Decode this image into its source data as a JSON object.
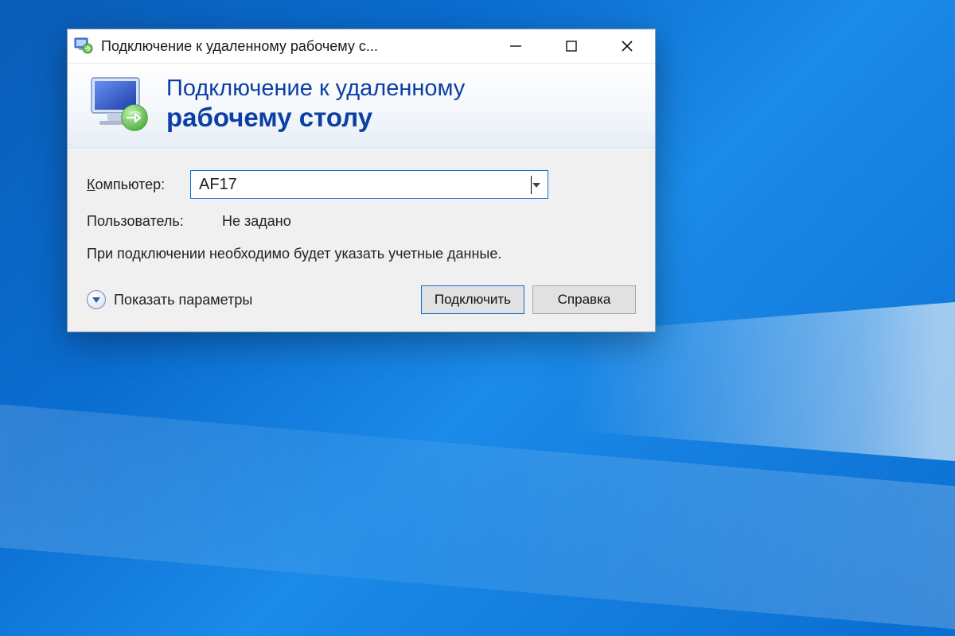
{
  "titlebar": {
    "title": "Подключение к удаленному рабочему с..."
  },
  "banner": {
    "line1": "Подключение к удаленному",
    "line2": "рабочему столу"
  },
  "form": {
    "computer_label": "Компьютер:",
    "computer_value": "AF17",
    "user_label": "Пользователь:",
    "user_value": "Не задано",
    "hint": "При подключении необходимо будет указать учетные данные."
  },
  "footer": {
    "expand_label": "Показать параметры",
    "connect_label": "Подключить",
    "help_label": "Справка"
  }
}
